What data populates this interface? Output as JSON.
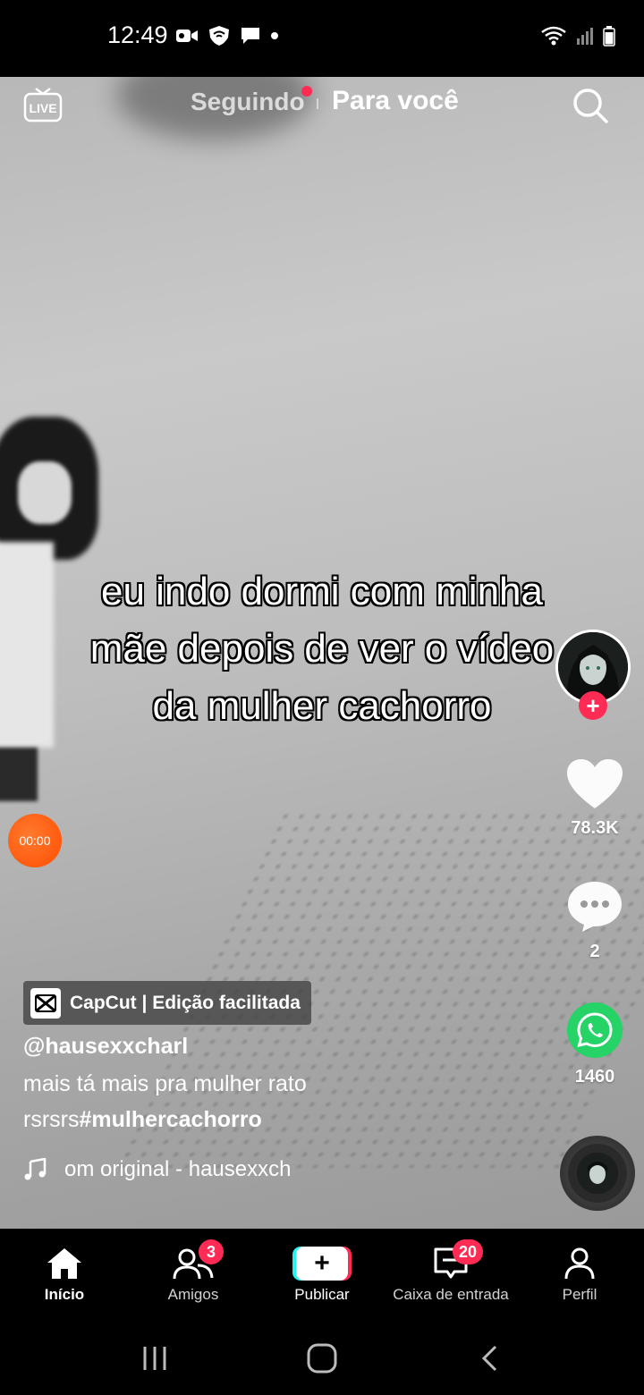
{
  "status_bar": {
    "time": "12:49"
  },
  "top_nav": {
    "live_label": "LIVE",
    "following_label": "Seguindo",
    "for_you_label": "Para você"
  },
  "video": {
    "caption_lines": [
      "eu indo dormi com minha",
      "mãe depois de ver o vídeo",
      "da mulher cachorro"
    ],
    "timer": "00:00"
  },
  "actions": {
    "likes": "78.3K",
    "comments": "2",
    "shares": "1460"
  },
  "post": {
    "capcut_badge": "CapCut | Edição facilitada",
    "username": "@hausexxcharl",
    "description_line1": "mais tá mais pra mulher rato",
    "description_line2_prefix": "rsrsrs",
    "description_hashtag": "#mulhercachorro",
    "sound": "om original - hausexxch"
  },
  "bottom_nav": {
    "home_label": "Início",
    "friends_label": "Amigos",
    "friends_badge": "3",
    "publish_label": "Publicar",
    "inbox_label": "Caixa de entrada",
    "inbox_badge": "20",
    "profile_label": "Perfil"
  },
  "colors": {
    "accent_red": "#fe2c55",
    "accent_cyan": "#25f4ee",
    "whatsapp_green": "#25d366",
    "timer_orange": "#ff4d00"
  }
}
